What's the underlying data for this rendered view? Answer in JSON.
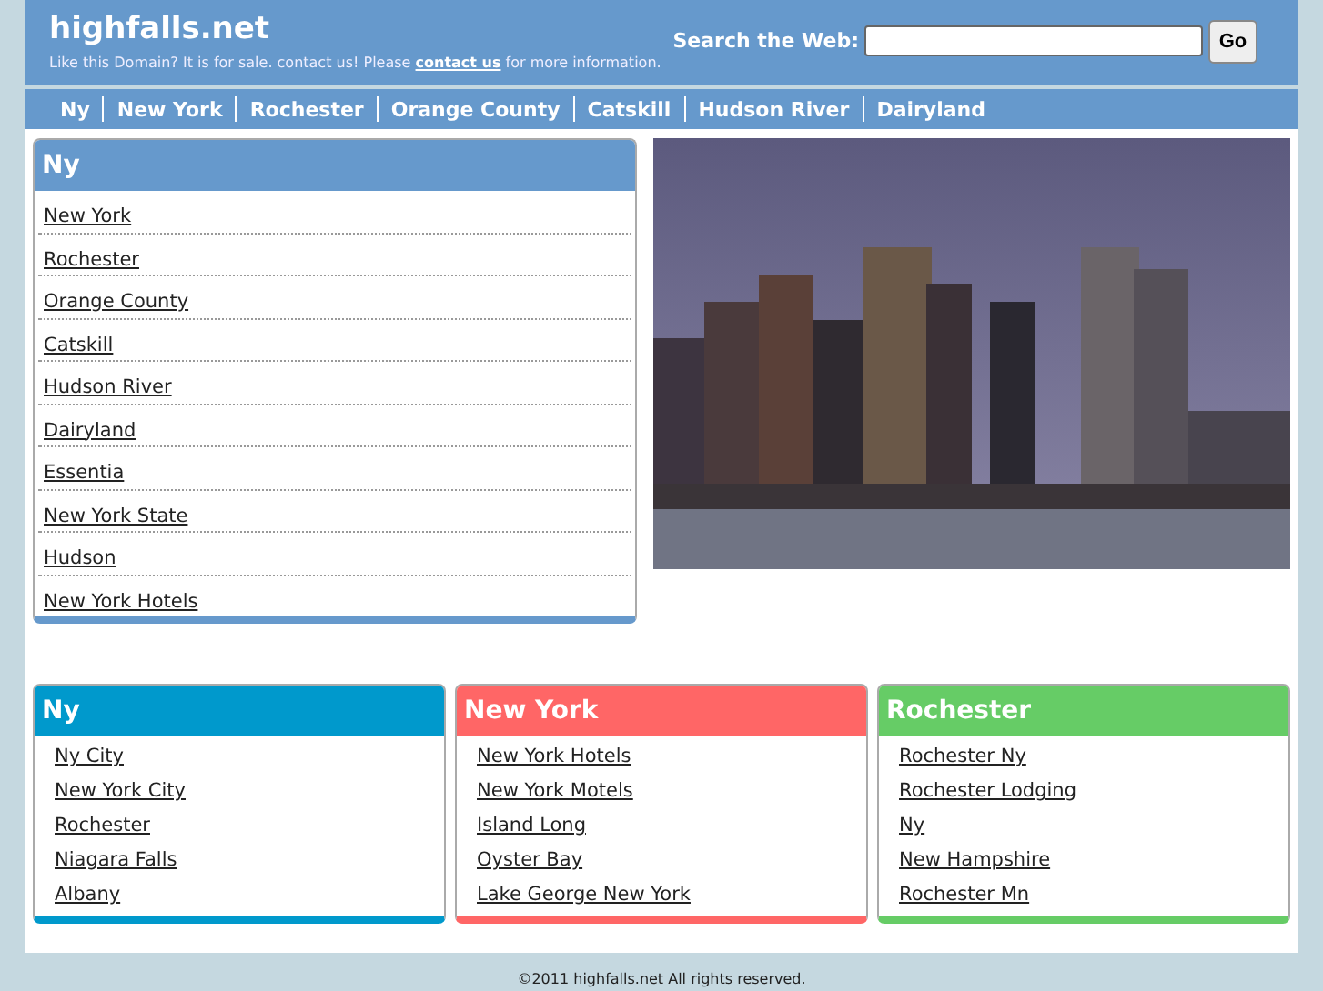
{
  "header": {
    "site_title": "highfalls.net",
    "tagline_before": "Like this Domain? It is for sale. contact us! Please",
    "contact_link": "contact us",
    "tagline_after": "for more information.",
    "search": {
      "label": "Search the Web:",
      "button": "Go"
    }
  },
  "nav": [
    "Ny",
    "New York",
    "Rochester",
    "Orange County",
    "Catskill",
    "Hudson River",
    "Dairyland"
  ],
  "sidebar": {
    "title": "Ny",
    "color": "#6699cc",
    "links": [
      "New York",
      "Rochester",
      "Orange County",
      "Catskill",
      "Hudson River",
      "Dairyland",
      "Essentia",
      "New York State",
      "Hudson",
      "New York Hotels"
    ]
  },
  "boxes": [
    {
      "title": "Ny",
      "color": "#0099cc",
      "links": [
        "Ny City",
        "New York City",
        "Rochester",
        "Niagara Falls",
        "Albany"
      ]
    },
    {
      "title": "New York",
      "color": "#ff6666",
      "links": [
        "New York Hotels",
        "New York Motels",
        "Island Long",
        "Oyster Bay",
        "Lake George New York"
      ]
    },
    {
      "title": "Rochester",
      "color": "#66cc66",
      "links": [
        "Rochester Ny",
        "Rochester Lodging",
        "Ny",
        "New Hampshire",
        "Rochester Mn"
      ]
    }
  ],
  "footer": "©2011 highfalls.net All rights reserved."
}
